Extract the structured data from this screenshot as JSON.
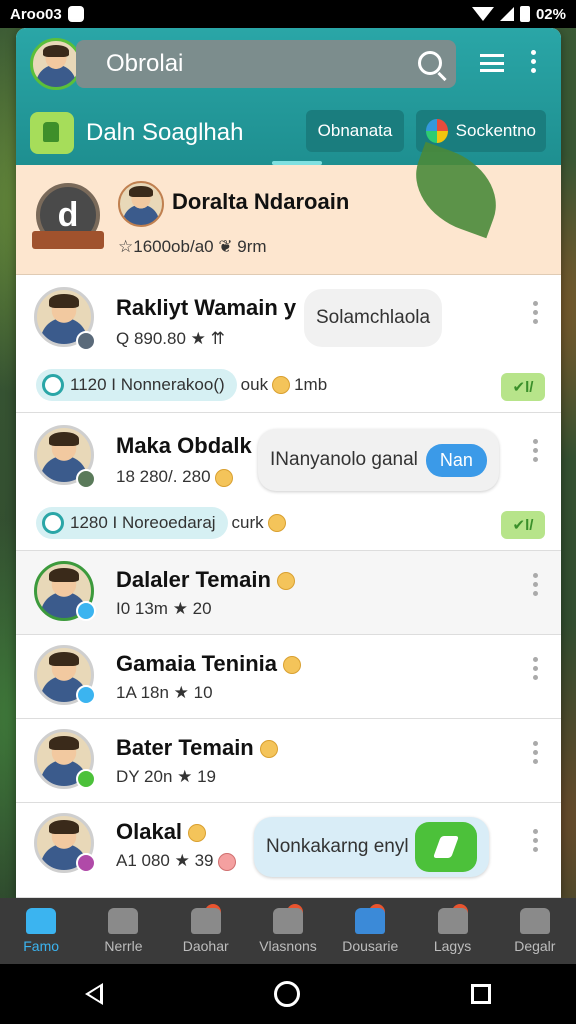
{
  "statusbar": {
    "carrier": "Aroo03",
    "battery": "02%"
  },
  "header": {
    "search_placeholder": "Obrolai",
    "group_title": "Daln Soaglhah",
    "chips": [
      "Obnanata",
      "Sockentno"
    ]
  },
  "featured": {
    "badge_label": "d",
    "name": "Doralta Ndaroain",
    "meta": "☆1600ob/a0 ❦ 9rm"
  },
  "chats": [
    {
      "name": "Rakliyt Wamain y",
      "meta": "Q 890.80 ★ ⇈",
      "bubble": "Solamchlaola",
      "sub_count": "1120 I Nonnerakoo()",
      "sub_text": "ouk",
      "sub_extra": "1mb",
      "action": "✔l/"
    },
    {
      "name": "Maka Obdalk",
      "meta": "18 280/. 280",
      "bubble": "INanyanolo ganal",
      "bubble_btn": "Nan",
      "sub_count": "1280 I Noreoedaraj",
      "sub_text": "curk",
      "action": "✔l/"
    },
    {
      "name": "Dalaler Temain",
      "meta": "I0 13m ★ 20"
    },
    {
      "name": "Gamaia Teninia",
      "meta": "1A 18n ★ 10"
    },
    {
      "name": "Bater Temain",
      "meta": "DY 20n ★ 19"
    },
    {
      "name": "Olakal",
      "meta": "A1 080 ★ 39",
      "bubble": "Nonkakarng enyl"
    }
  ],
  "bottom_nav": [
    "Famo",
    "Nerrle",
    "Daohar",
    "Vlasnons",
    "Dousarie",
    "Lagys",
    "Degalr"
  ],
  "icons": {
    "search": "search-icon",
    "menu": "menu-icon",
    "more": "more-vert-icon",
    "back": "back-icon",
    "home": "home-icon",
    "recents": "recents-icon"
  },
  "colors": {
    "header": "#2aa6a7",
    "featured_bg": "#fde6cf",
    "accent_blue": "#3b9ae8",
    "accent_green": "#4cc13a"
  }
}
